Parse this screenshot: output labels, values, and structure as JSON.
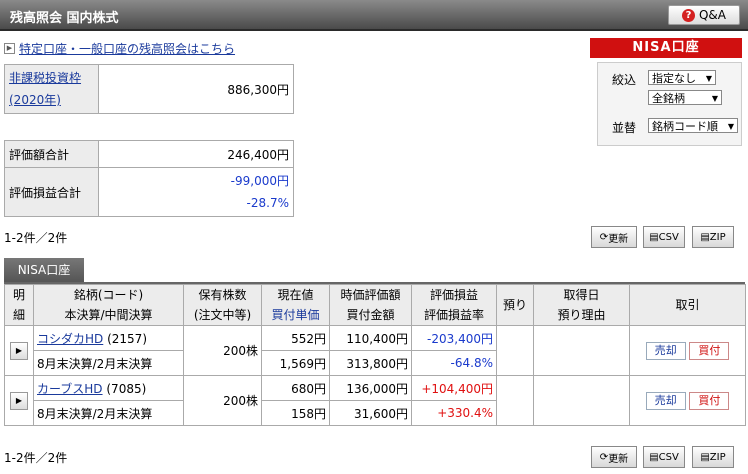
{
  "header": {
    "title": "残高照会 国内株式",
    "qa_label": "Q&A"
  },
  "link_text": "特定口座・一般口座の残高照会はこちら",
  "tax_free": {
    "label_line1": "非課税投資枠",
    "label_line2": "(2020年)",
    "value": "886,300円"
  },
  "totals": {
    "eval_label": "評価額合計",
    "eval_value": "246,400円",
    "pl_label": "評価損益合計",
    "pl_value": "-99,000円",
    "pl_pct": "-28.7%"
  },
  "count_top": "1-2件／2件",
  "count_bottom": "1-2件／2件",
  "nisa_header": "NISA口座",
  "filter": {
    "narrow_label": "絞込",
    "narrow_value1": "指定なし",
    "narrow_value2": "全銘柄",
    "sort_label": "並替",
    "sort_value": "銘柄コード順"
  },
  "toolbar": {
    "refresh": "更新",
    "csv": "CSV",
    "zip": "ZIP"
  },
  "tab_label": "NISA口座",
  "columns": {
    "detail": [
      "明",
      "細"
    ],
    "name": [
      "銘柄(コード)",
      "本決算/中間決算"
    ],
    "qty": [
      "保有株数",
      "(注文中等)"
    ],
    "price": [
      "現在値",
      "買付単価"
    ],
    "eval": [
      "時価評価額",
      "買付金額"
    ],
    "pl": [
      "評価損益",
      "評価損益率"
    ],
    "deposit": "預り",
    "acq": [
      "取得日",
      "預り理由"
    ],
    "trade": "取引"
  },
  "rows": [
    {
      "name": "コシダカHD",
      "code": "(2157)",
      "settle": "8月末決算/2月末決算",
      "qty": "200株",
      "price": "552円",
      "unit": "1,569円",
      "eval": "110,400円",
      "cost": "313,800円",
      "pl": "-203,400円",
      "pl_pct": "-64.8%",
      "sell": "売却",
      "buy": "買付"
    },
    {
      "name": "カーブスHD",
      "code": "(7085)",
      "settle": "8月末決算/2月末決算",
      "qty": "200株",
      "price": "680円",
      "unit": "158円",
      "eval": "136,000円",
      "cost": "31,600円",
      "pl": "+104,400円",
      "pl_pct": "+330.4%",
      "sell": "売却",
      "buy": "買付"
    }
  ]
}
